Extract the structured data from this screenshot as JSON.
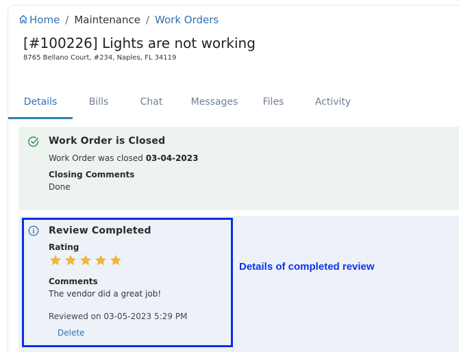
{
  "breadcrumb": {
    "home": "Home",
    "maintenance": "Maintenance",
    "work_orders": "Work Orders",
    "separator": "/"
  },
  "work_order": {
    "title": "[#100226] Lights are not working",
    "address": "8765 Bellano Court, #234, Naples, FL 34119"
  },
  "tabs": [
    {
      "label": "Details",
      "active": true
    },
    {
      "label": "Bills",
      "active": false
    },
    {
      "label": "Chat",
      "active": false
    },
    {
      "label": "Messages",
      "active": false
    },
    {
      "label": "Files",
      "active": false
    },
    {
      "label": "Activity",
      "active": false
    }
  ],
  "closed_panel": {
    "title": "Work Order is Closed",
    "closed_text": "Work Order was closed ",
    "closed_date": "03-04-2023",
    "comments_label": "Closing Comments",
    "comments_value": "Done"
  },
  "review_panel": {
    "title": "Review Completed",
    "rating_label": "Rating",
    "rating_value": 5,
    "rating_max": 5,
    "comments_label": "Comments",
    "comments_value": "The vendor did a great job!",
    "reviewed_on": "Reviewed on 03-05-2023 5:29 PM",
    "delete_label": "Delete"
  },
  "annotation": "Details of completed review",
  "colors": {
    "link": "#2f6fb1",
    "star": "#f2b43a",
    "closed_bg": "#edf4ef",
    "review_bg": "#edf2f8",
    "highlight": "#0b2ce8",
    "annotation": "#1030ee"
  }
}
